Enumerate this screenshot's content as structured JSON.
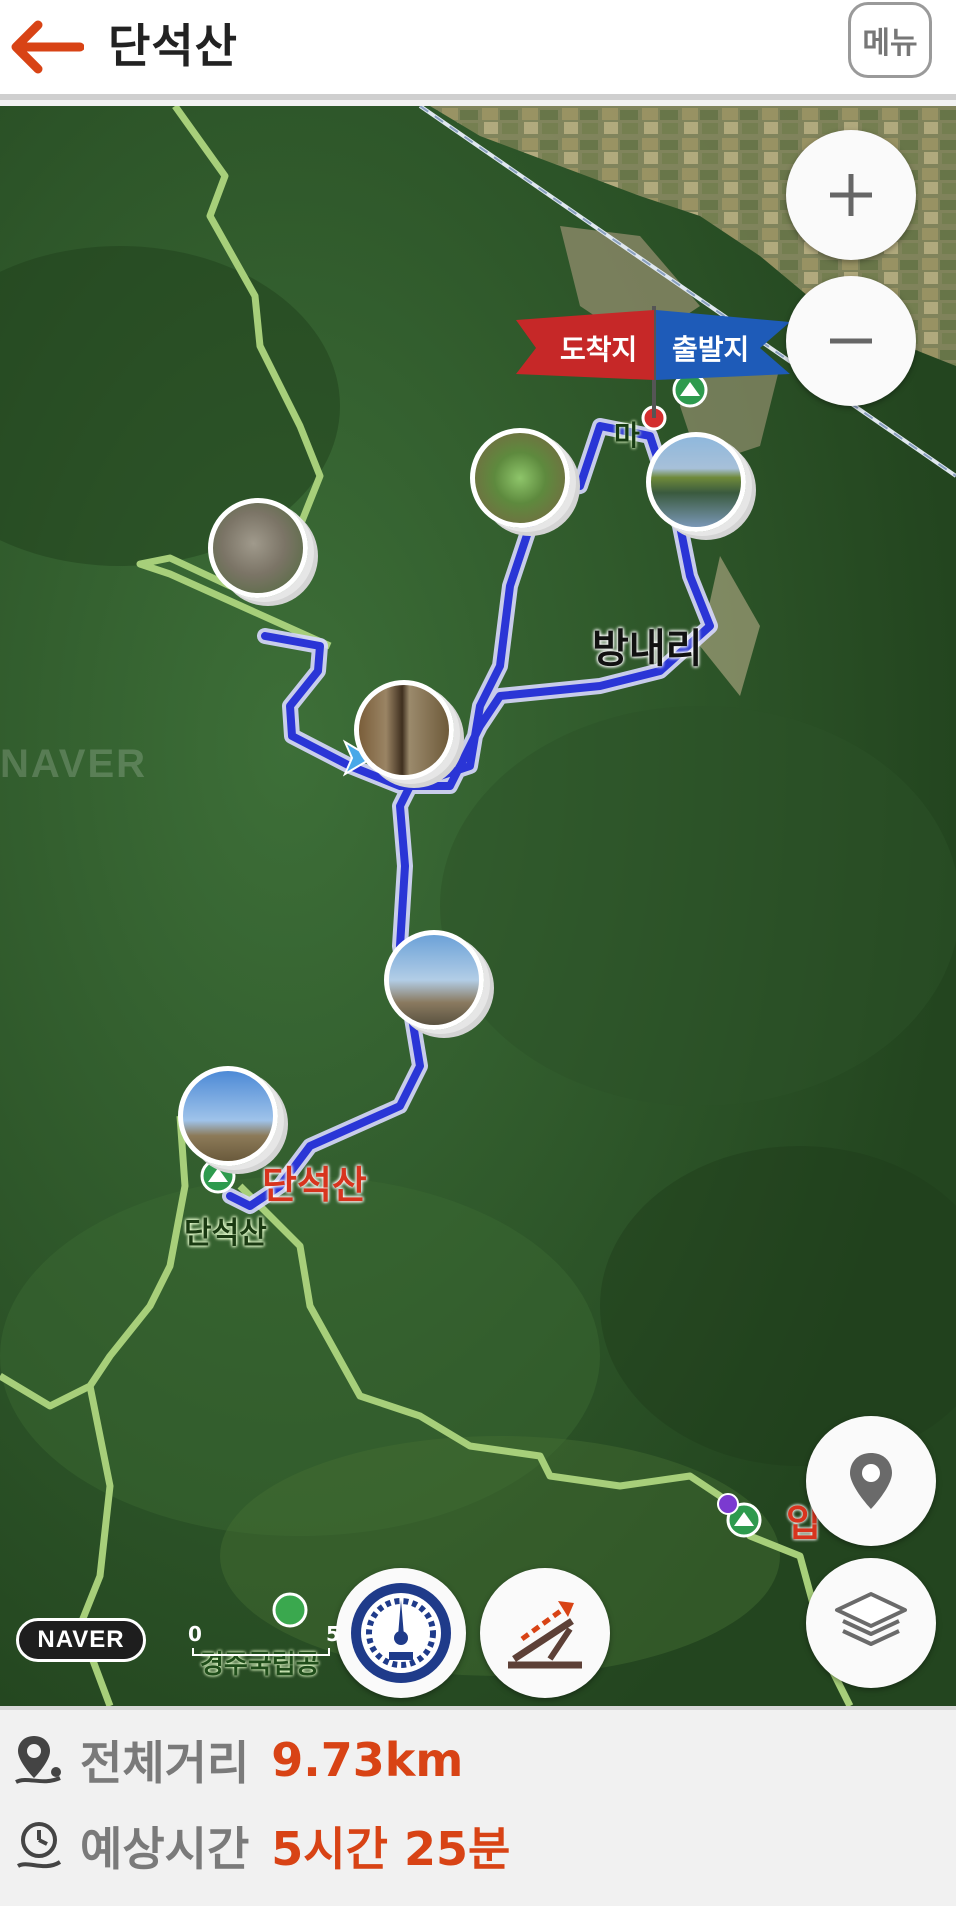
{
  "header": {
    "title": "단석산",
    "menu_label": "메뉴"
  },
  "map": {
    "flags": {
      "arrival": "도착지",
      "departure": "출발지"
    },
    "labels": {
      "village": "방내리",
      "peak_red": "단석산",
      "peak_green": "단석산",
      "park": "경주국립공",
      "entrance": "입",
      "upper": "마"
    },
    "provider": "NAVER",
    "scale": {
      "zero": "0",
      "five": "5"
    },
    "route_color": "#2a35d6",
    "trail_color": "#a7cf7a"
  },
  "summary": {
    "distance_label": "전체거리",
    "distance_value": "9.73km",
    "time_label": "예상시간",
    "time_value": "5시간 25분",
    "accent_color": "#d84315"
  },
  "icons": [
    "back-arrow-icon",
    "plus-icon",
    "minus-icon",
    "location-pin-icon",
    "layers-icon",
    "speedometer-icon",
    "elevation-icon",
    "map-pin-icon",
    "clock-icon"
  ]
}
